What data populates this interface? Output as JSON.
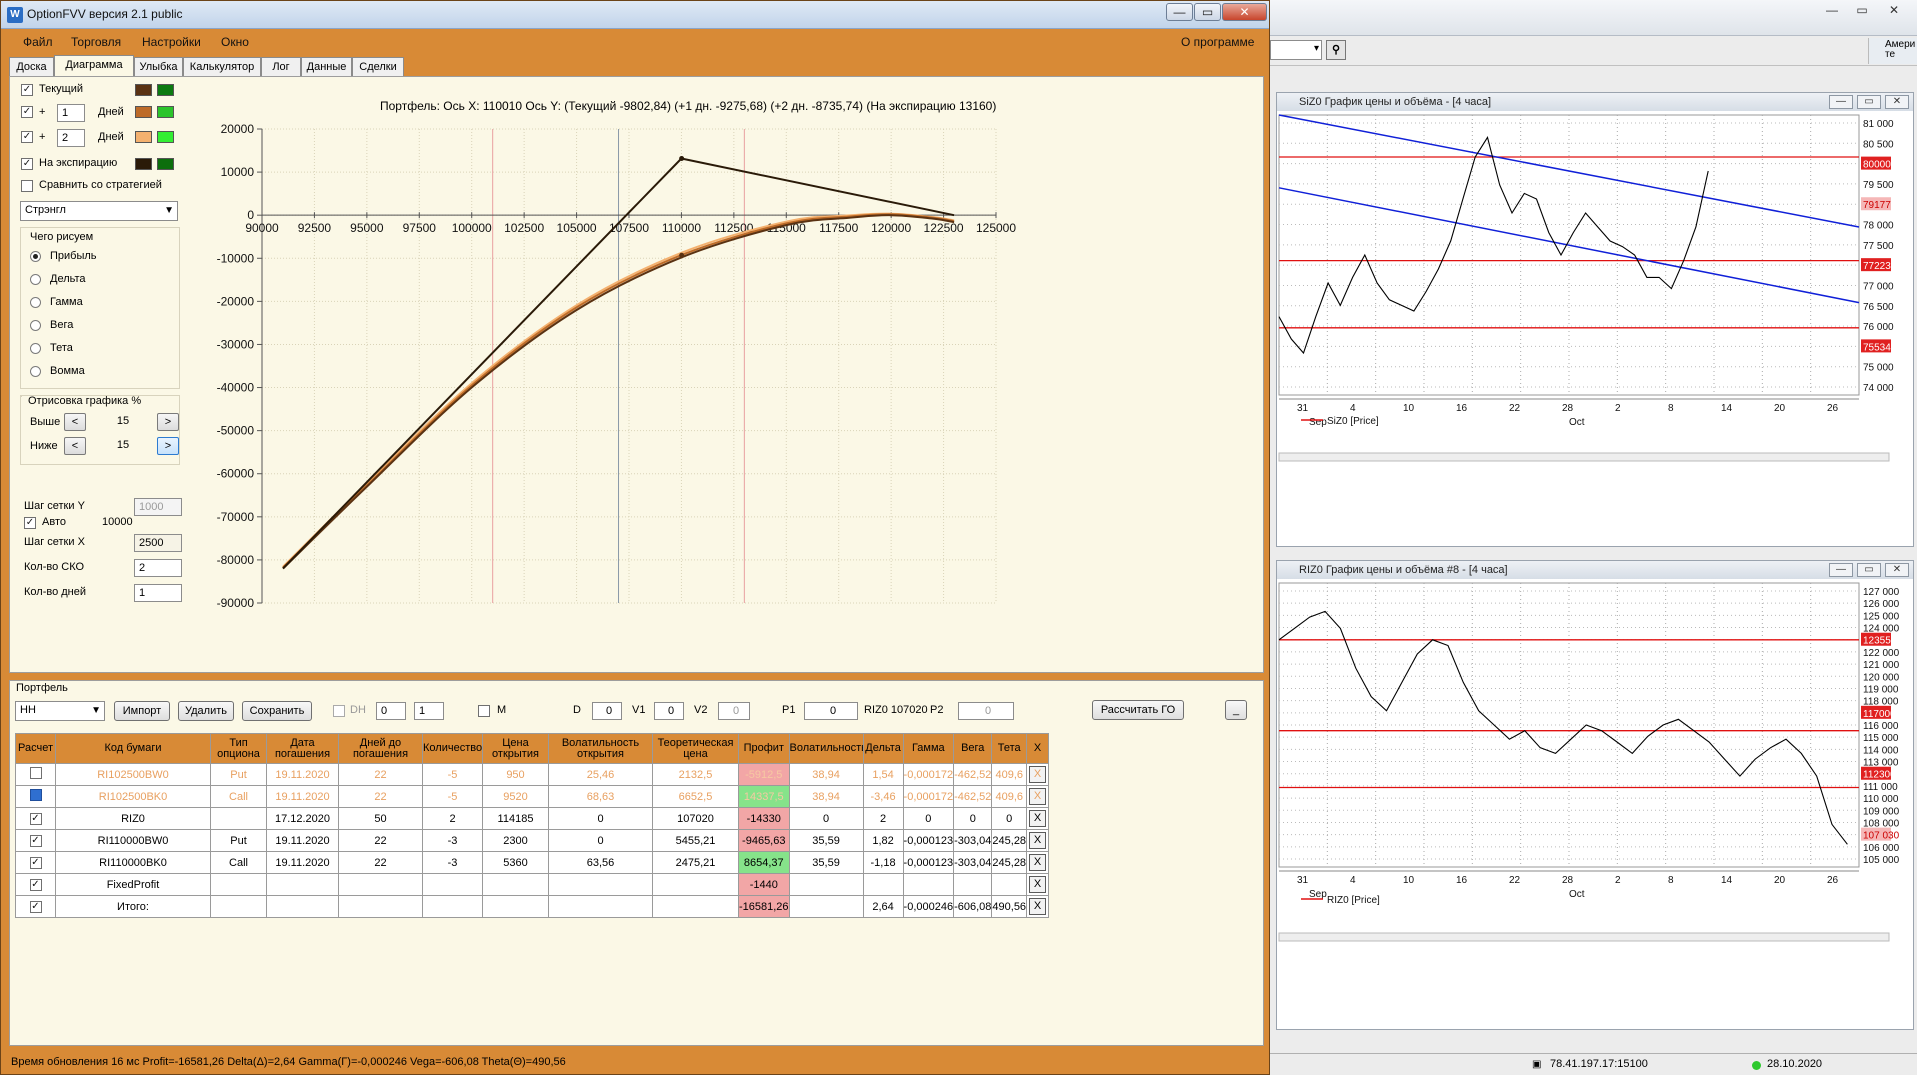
{
  "window": {
    "title": "OptionFVV версия 2.1 public",
    "icon": "app-icon",
    "btn_min": "—",
    "btn_max": "▭",
    "btn_close": "✕"
  },
  "menu": {
    "items": [
      "Файл",
      "Торговля",
      "Настройки",
      "Окно"
    ],
    "about": "О программе"
  },
  "tabs": [
    "Доска",
    "Диаграмма",
    "Улыбка",
    "Калькулятор",
    "Лог",
    "Данные",
    "Сделки"
  ],
  "active_tab": "Диаграмма",
  "sidebar": {
    "series": [
      {
        "label": "Текущий",
        "checked": true,
        "color1": "#5a3212",
        "color2": "#0c7a10"
      },
      {
        "label": "Дней",
        "prefix": "+",
        "days": "1",
        "checked": true,
        "color1": "#bd6b28",
        "color2": "#2bc42b"
      },
      {
        "label": "Дней",
        "prefix": "+",
        "days": "2",
        "checked": true,
        "color1": "#f4b16f",
        "color2": "#33ee33"
      },
      {
        "label": "На экспирацию",
        "checked": true,
        "color1": "#2a1a08",
        "color2": "#0c6e0c"
      }
    ],
    "compare_label": "Сравнить со стратегией",
    "strategy_select": "Стрэнгл",
    "draw_group_title": "Чего рисуем",
    "draw_options": [
      "Прибыль",
      "Дельта",
      "Гамма",
      "Вега",
      "Тета",
      "Вомма"
    ],
    "draw_selected": "Прибыль",
    "render_group_title": "Отрисовка графика %",
    "above_label": "Выше",
    "above_value": "15",
    "below_label": "Ниже",
    "below_value": "15",
    "btn_left": "<",
    "btn_right": ">",
    "grid_y_label": "Шаг сетки Y",
    "grid_y_value": "1000",
    "auto_label": "Авто",
    "auto_value": "10000",
    "grid_x_label": "Шаг сетки X",
    "grid_x_value": "2500",
    "sko_label": "Кол-во СКО",
    "sko_value": "2",
    "days_label": "Кол-во дней",
    "days_value": "1"
  },
  "chart_header": "Портфель:  Ось X:  110010  Ось Y:   (Текущий -9802,84)   (+1 дн. -9275,68)   (+2 дн. -8735,74)   (На экспирацию 13160)",
  "chart_data": {
    "type": "line",
    "title": "Портфель:  Ось X:  110010  Ось Y:   (Текущий -9802,84)   (+1 дн. -9275,68)   (+2 дн. -8735,74)   (На экспирацию 13160)",
    "xlim": [
      90000,
      125000
    ],
    "ylim": [
      -90000,
      25000
    ],
    "xticks": [
      90000,
      92500,
      95000,
      97500,
      100000,
      102500,
      105000,
      107500,
      110000,
      112500,
      115000,
      117500,
      120000,
      122500,
      125000
    ],
    "yticks": [
      20000,
      10000,
      0,
      -10000,
      -20000,
      -30000,
      -40000,
      -50000,
      -60000,
      -70000,
      -80000,
      -90000
    ],
    "vlines": [
      {
        "x": 101000,
        "color": "#e8a0a0"
      },
      {
        "x": 107000,
        "color": "#8a9aa8"
      },
      {
        "x": 113000,
        "color": "#e8a0a0"
      }
    ],
    "cursor": {
      "x": 110010
    },
    "series": [
      {
        "name": "На экспирацию",
        "color": "#2a1a08",
        "x": [
          91000,
          110000,
          123000
        ],
        "y": [
          -82000,
          13160,
          0
        ]
      },
      {
        "name": "Текущий",
        "color": "#5a3212",
        "x": [
          91000,
          95000,
          100000,
          105000,
          110000,
          115000,
          118000,
          120000,
          122000,
          123000
        ],
        "y": [
          -82000,
          -63000,
          -40000,
          -22000,
          -9800,
          -2300,
          -600,
          0,
          -800,
          -1600
        ]
      },
      {
        "name": "+1 дн.",
        "color": "#bd6b28",
        "x": [
          91000,
          95000,
          100000,
          105000,
          110000,
          115000,
          118000,
          120000,
          122000,
          123000
        ],
        "y": [
          -81800,
          -62700,
          -39500,
          -21400,
          -9275,
          -1900,
          -300,
          200,
          -600,
          -1400
        ]
      },
      {
        "name": "+2 дн.",
        "color": "#f4b16f",
        "x": [
          91000,
          95000,
          100000,
          105000,
          110000,
          115000,
          118000,
          120000,
          122000,
          123000
        ],
        "y": [
          -81600,
          -62300,
          -39000,
          -20900,
          -8735,
          -1500,
          -50,
          350,
          -450,
          -1200
        ]
      }
    ]
  },
  "portfolio": {
    "panel_title": "Портфель",
    "select_value": "HH",
    "btn_import": "Импорт",
    "btn_delete": "Удалить",
    "btn_save": "Сохранить",
    "dh_label": "DH",
    "spin1": "0",
    "spin2": "1",
    "m_label": "M",
    "d_label": "D",
    "d_value": "0",
    "v1_label": "V1",
    "v1_value": "0",
    "v2_label": "V2",
    "v2_value": "0",
    "p1_label": "P1",
    "p1_value": "0",
    "riz_label": "RIZ0 107020",
    "p2_label": "P2",
    "p2_value": "0",
    "btn_go": "Рассчитать ГО",
    "btn_min": "_",
    "columns": [
      "Расчет",
      "Код бумаги",
      "Тип опциона",
      "Дата погашения",
      "Дней до погашения",
      "Количество",
      "Цена открытия",
      "Волатильность открытия",
      "Теоретическая цена",
      "Профит",
      "Волатильность",
      "Дельта",
      "Гамма",
      "Вега",
      "Тета",
      "X"
    ],
    "rows": [
      {
        "calc": "",
        "code": "RI102500BW0",
        "type": "Put",
        "date": "19.11.2020",
        "days": "22",
        "qty": "-5",
        "open": "950",
        "vol_open": "25,46",
        "theor": "2132,5",
        "profit": "-5912,5",
        "vol": "38,94",
        "delta": "1,54",
        "gamma": "-0,000172",
        "vega": "-462,52",
        "theta": "409,6",
        "x": "X",
        "dim": true,
        "profit_cls": "pink"
      },
      {
        "calc": "",
        "code": "RI102500BK0",
        "type": "Call",
        "date": "19.11.2020",
        "days": "22",
        "qty": "-5",
        "open": "9520",
        "vol_open": "68,63",
        "theor": "6652,5",
        "profit": "14337,5",
        "vol": "38,94",
        "delta": "-3,46",
        "gamma": "-0,000172",
        "vega": "-462,52",
        "theta": "409,6",
        "x": "X",
        "dim": true,
        "profit_cls": "green",
        "selected": true
      },
      {
        "calc": "✓",
        "code": "RIZ0",
        "type": "",
        "date": "17.12.2020",
        "days": "50",
        "qty": "2",
        "open": "114185",
        "vol_open": "0",
        "theor": "107020",
        "profit": "-14330",
        "vol": "0",
        "delta": "2",
        "gamma": "0",
        "vega": "0",
        "theta": "0",
        "x": "X",
        "profit_cls": "pink"
      },
      {
        "calc": "✓",
        "code": "RI110000BW0",
        "type": "Put",
        "date": "19.11.2020",
        "days": "22",
        "qty": "-3",
        "open": "2300",
        "vol_open": "0",
        "theor": "5455,21",
        "profit": "-9465,63",
        "vol": "35,59",
        "delta": "1,82",
        "gamma": "-0,000123",
        "vega": "-303,04",
        "theta": "245,28",
        "x": "X",
        "profit_cls": "pink"
      },
      {
        "calc": "✓",
        "code": "RI110000BK0",
        "type": "Call",
        "date": "19.11.2020",
        "days": "22",
        "qty": "-3",
        "open": "5360",
        "vol_open": "63,56",
        "theor": "2475,21",
        "profit": "8654,37",
        "vol": "35,59",
        "delta": "-1,18",
        "gamma": "-0,000123",
        "vega": "-303,04",
        "theta": "245,28",
        "x": "X",
        "profit_cls": "green"
      },
      {
        "calc": "✓",
        "code": "FixedProfit",
        "type": "",
        "date": "",
        "days": "",
        "qty": "",
        "open": "",
        "vol_open": "",
        "theor": "",
        "profit": "-1440",
        "vol": "",
        "delta": "",
        "gamma": "",
        "vega": "",
        "theta": "",
        "x": "X",
        "profit_cls": "pink"
      },
      {
        "calc": "✓",
        "code": "Итого:",
        "type": "",
        "date": "",
        "days": "",
        "qty": "",
        "open": "",
        "vol_open": "",
        "theor": "",
        "profit": "-16581,26",
        "vol": "",
        "delta": "2,64",
        "gamma": "-0,000246",
        "vega": "-606,08",
        "theta": "490,56",
        "x": "X",
        "profit_cls": "pink"
      }
    ]
  },
  "statusbar": "Время обновления 16 мс  Profit=-16581,26 Delta(Δ)=2,64 Gamma(Γ)=-0,000246 Vega=-606,08 Theta(Θ)=490,56",
  "right_app": {
    "top_btns": [
      "—",
      "▭",
      "✕"
    ],
    "account_label": "Амери те",
    "chart1": {
      "title": "SiZ0 График цены и объёма - [4 часа]",
      "legend": "SiZ0 [Price]",
      "price_ticks": [
        "81 000",
        "80 500",
        "80000",
        "79 500",
        "79177",
        "78 000",
        "77 500",
        "77223",
        "77 000",
        "76 500",
        "76 000",
        "75534",
        "75 000",
        "74 000"
      ],
      "date_ticks": [
        "31",
        "4",
        "10",
        "16",
        "22",
        "28",
        "2",
        "8",
        "14",
        "20",
        "26"
      ],
      "months": [
        "Sep",
        "Oct"
      ]
    },
    "chart2": {
      "title": "RIZ0 График цены и объёма #8 - [4 часа]",
      "legend": "RIZ0 [Price]",
      "price_ticks": [
        "127 000",
        "126 000",
        "125 000",
        "124 000",
        "123550",
        "122 000",
        "121 000",
        "120 000",
        "119 000",
        "118 000",
        "117000",
        "116 000",
        "115 000",
        "114 000",
        "113 000",
        "112300",
        "111 000",
        "110 000",
        "109 000",
        "108 000",
        "107 030",
        "106 000",
        "105 000"
      ],
      "date_ticks": [
        "31",
        "4",
        "10",
        "16",
        "22",
        "28",
        "2",
        "8",
        "14",
        "20",
        "26"
      ],
      "months": [
        "Sep",
        "Oct"
      ]
    },
    "status": {
      "ip": "78.41.197.17:15100",
      "date": "28.10.2020"
    }
  }
}
